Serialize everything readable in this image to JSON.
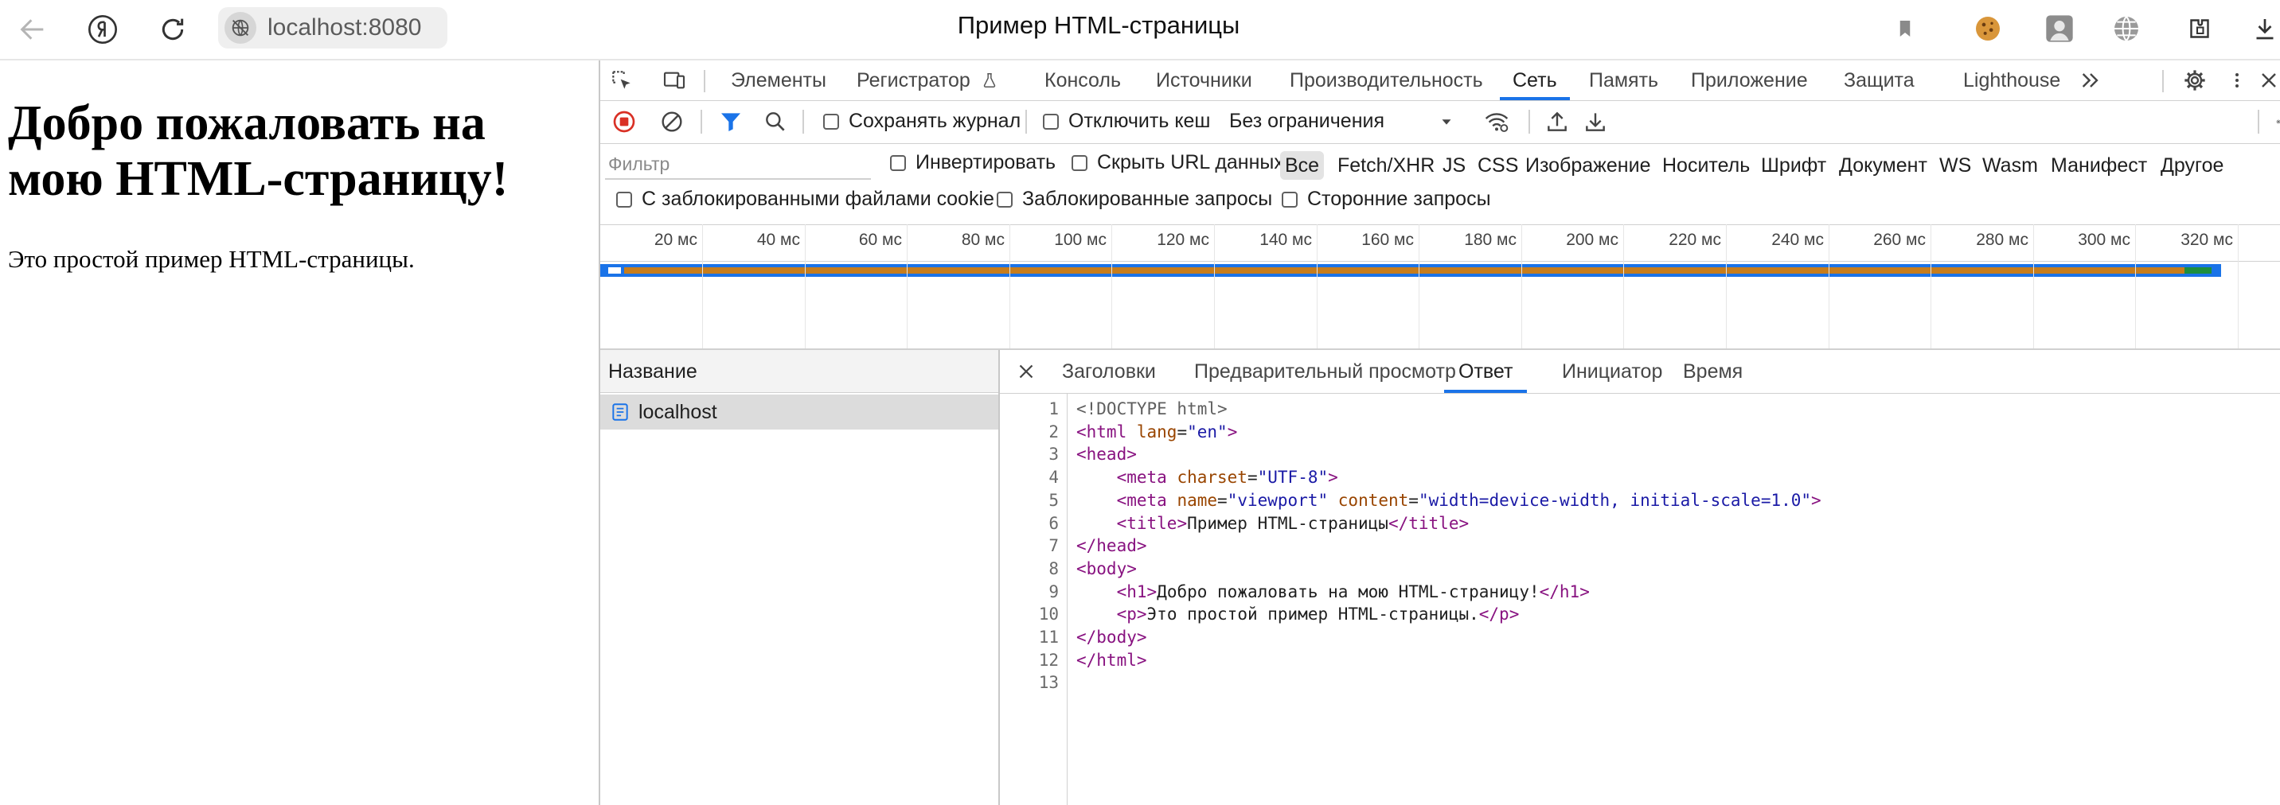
{
  "browser": {
    "url": "localhost:8080",
    "window_title": "Пример HTML-страницы"
  },
  "page": {
    "heading": "Добро пожаловать на мою HTML-страницу!",
    "paragraph": "Это простой пример HTML-страницы."
  },
  "devtools": {
    "tabs": [
      "Элементы",
      "Регистратор",
      "Консоль",
      "Источники",
      "Производительность",
      "Сеть",
      "Память",
      "Приложение",
      "Защита",
      "Lighthouse"
    ],
    "active_tab": "Сеть",
    "toolbar": {
      "preserve_log": "Сохранять журнал",
      "disable_cache": "Отключить кеш",
      "throttling": "Без ограничения"
    },
    "filter": {
      "placeholder": "Фильтр",
      "invert": "Инвертировать",
      "hide_data_urls": "Скрыть URL данных",
      "types": [
        "Все",
        "Fetch/XHR",
        "JS",
        "CSS",
        "Изображение",
        "Носитель",
        "Шрифт",
        "Документ",
        "WS",
        "Wasm",
        "Манифест",
        "Другое"
      ],
      "selected_type": "Все",
      "blocked_cookies": "С заблокированными файлами cookie",
      "blocked_requests": "Заблокированные запросы",
      "third_party": "Сторонние запросы"
    },
    "timeline_ticks": [
      "20 мс",
      "40 мс",
      "60 мс",
      "80 мс",
      "100 мс",
      "120 мс",
      "140 мс",
      "160 мс",
      "180 мс",
      "200 мс",
      "220 мс",
      "240 мс",
      "260 мс",
      "280 мс",
      "300 мс",
      "320 мс"
    ],
    "requests": {
      "column_name": "Название",
      "rows": [
        "localhost"
      ]
    },
    "detail_tabs": [
      "Заголовки",
      "Предварительный просмотр",
      "Ответ",
      "Инициатор",
      "Время"
    ],
    "active_detail_tab": "Ответ",
    "response_lines": [
      "<!DOCTYPE html>",
      "<html lang=\"en\">",
      "<head>",
      "    <meta charset=\"UTF-8\">",
      "    <meta name=\"viewport\" content=\"width=device-width, initial-scale=1.0\">",
      "    <title>Пример HTML-страницы</title>",
      "</head>",
      "<body>",
      "    <h1>Добро пожаловать на мою HTML-страницу!</h1>",
      "    <p>Это простой пример HTML-страницы.</p>",
      "</body>",
      "</html>",
      ""
    ]
  },
  "colors": {
    "accent": "#1a73e8",
    "record": "#d93025",
    "bar_gold": "#c77d1c",
    "bar_green": "#1e8e3e"
  }
}
